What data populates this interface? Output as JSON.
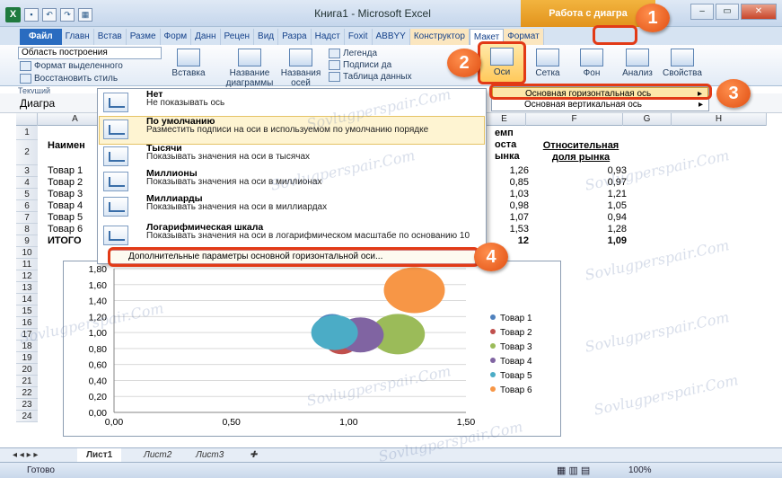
{
  "window": {
    "title": "Книга1 - Microsoft Excel",
    "context_tab_group": "Работа с диагра"
  },
  "tabs": [
    "Файл",
    "Главн",
    "Встав",
    "Разме",
    "Форм",
    "Данн",
    "Рецен",
    "Вид",
    "Разра",
    "Надст",
    "Foxit",
    "ABBYY",
    "Конструктор",
    "Макет",
    "Формат"
  ],
  "ribbon": {
    "selector_value": "Область построения",
    "format_selection": "Формат выделенного",
    "restore_style": "Восстановить стиль",
    "group_label": "Текущий",
    "insert": "Вставка",
    "chart_title": "Название диаграммы",
    "axis_titles": "Названия осей",
    "legend": "Легенда",
    "data_labels": "Подписи да",
    "data_table": "Таблица данных",
    "axes": "Оси",
    "gridlines": "Сетка",
    "background": "Фон",
    "analysis": "Анализ",
    "properties": "Свойства"
  },
  "name_box": "Диагра",
  "columns": [
    "A",
    "B",
    "C",
    "D",
    "E",
    "F",
    "G",
    "H"
  ],
  "rows": [
    "1",
    "2",
    "3",
    "4",
    "5",
    "6",
    "7",
    "8",
    "9",
    "10",
    "11",
    "12",
    "13",
    "14",
    "15",
    "16",
    "17",
    "18",
    "19",
    "20",
    "21",
    "22",
    "23",
    "24"
  ],
  "table": {
    "header_a": "Наимен",
    "header_e": [
      "емп",
      "оста",
      "ынка"
    ],
    "header_f": [
      "Относительная",
      "доля рынка"
    ],
    "row_labels": [
      "Товар 1",
      "Товар 2",
      "Товар 3",
      "Товар 4",
      "Товар 5",
      "Товар 6",
      "ИТОГО"
    ],
    "e_values": [
      "1,26",
      "0,85",
      "1,03",
      "0,98",
      "1,07",
      "1,53",
      "12"
    ],
    "f_values": [
      "0,93",
      "0,97",
      "1,21",
      "1,05",
      "0,94",
      "1,28",
      "1,09"
    ]
  },
  "axis_menu": {
    "items": [
      {
        "title": "Нет",
        "desc": "Не показывать ось"
      },
      {
        "title": "По умолчанию",
        "desc": "Разместить подписи на оси в используемом по умолчанию порядке"
      },
      {
        "title": "Тысячи",
        "desc": "Показывать значения на оси в тысячах"
      },
      {
        "title": "Миллионы",
        "desc": "Показывать значения на оси в миллионах"
      },
      {
        "title": "Миллиарды",
        "desc": "Показывать значения на оси в миллиардах"
      },
      {
        "title": "Логарифмическая шкала",
        "desc": "Показывать значения на оси в логарифмическом масштабе по основанию 10"
      }
    ],
    "more": "Дополнительные параметры основной горизонтальной оси..."
  },
  "submenu": {
    "horizontal": "Основная горизонтальная ось",
    "vertical": "Основная вертикальная ось"
  },
  "callouts": [
    "1",
    "2",
    "3",
    "4"
  ],
  "chart_data": {
    "type": "scatter",
    "subtype": "bubble",
    "xlim": [
      0,
      1.5
    ],
    "ylim": [
      0,
      1.8
    ],
    "x_ticks": [
      "0,00",
      "0,50",
      "1,00",
      "1,50"
    ],
    "y_ticks": [
      "0,00",
      "0,20",
      "0,40",
      "0,60",
      "0,80",
      "1,00",
      "1,20",
      "1,40",
      "1,60",
      "1,80"
    ],
    "series": [
      {
        "name": "Товар 1",
        "x": 0.93,
        "y": 1.08,
        "color": "#4f81bd"
      },
      {
        "name": "Товар 2",
        "x": 0.97,
        "y": 0.88,
        "color": "#c0504d"
      },
      {
        "name": "Товар 3",
        "x": 1.21,
        "y": 0.98,
        "color": "#9bbb59"
      },
      {
        "name": "Товар 4",
        "x": 1.05,
        "y": 0.97,
        "color": "#8064a2"
      },
      {
        "name": "Товар 5",
        "x": 0.94,
        "y": 1.0,
        "color": "#4bacc6"
      },
      {
        "name": "Товар 6",
        "x": 1.28,
        "y": 1.53,
        "color": "#f79646"
      }
    ]
  },
  "sheets": [
    "Лист1",
    "Лист2",
    "Лист3"
  ],
  "status": {
    "ready": "Готово",
    "zoom": "100%"
  },
  "watermark": "Sovlugperspair.Com"
}
